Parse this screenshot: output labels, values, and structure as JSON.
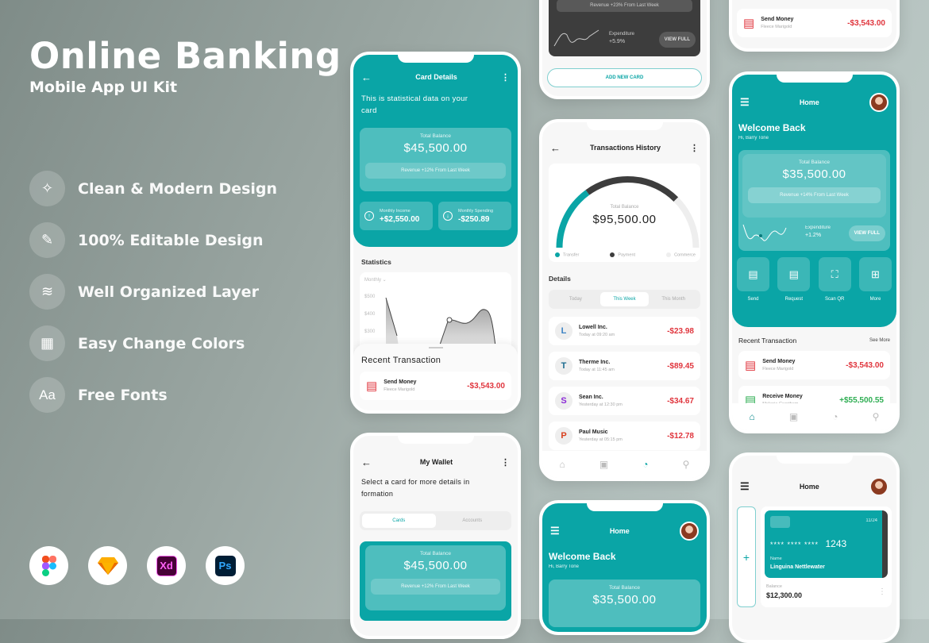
{
  "hero": {
    "title": "Online Banking",
    "subtitle": "Mobile App UI Kit"
  },
  "features": [
    {
      "icon": "magic-wand-icon",
      "glyph": "⁄",
      "label": "Clean & Modern Design"
    },
    {
      "icon": "pen-tool-icon",
      "glyph": "✎",
      "label": "100% Editable Design"
    },
    {
      "icon": "layers-icon",
      "glyph": "≋",
      "label": "Well Organized Layer"
    },
    {
      "icon": "color-swatch-icon",
      "glyph": "▦",
      "label": "Easy Change Colors"
    },
    {
      "icon": "font-icon",
      "glyph": "Aa",
      "label": "Free Fonts"
    }
  ],
  "tools": [
    {
      "name": "figma",
      "label": "F"
    },
    {
      "name": "sketch",
      "label": "◆"
    },
    {
      "name": "xd",
      "label": "Xd"
    },
    {
      "name": "photoshop",
      "label": "Ps"
    }
  ],
  "colors": {
    "accent": "#0aa5a6",
    "negative": "#e0363e",
    "positive": "#2fae53",
    "dark_card": "#3d3d3d"
  },
  "card_details": {
    "title": "Card Details",
    "intro": "This is statistical data on your card",
    "total_label": "Total Balance",
    "total_value": "$45,500.00",
    "revenue": "Revenue +12% From Last Week",
    "income_label": "Monthly Income",
    "income_value": "+$2,550.00",
    "spending_label": "Monthly Spending",
    "spending_value": "-$250.89",
    "stats_title": "Statistics",
    "period": "Monthly",
    "y_ticks": [
      "$500",
      "$400",
      "$300"
    ],
    "recent_title": "Recent Transaction",
    "tx": {
      "name": "Send Money",
      "sub": "Fleece Marigold",
      "amount": "-$3,543.00"
    }
  },
  "my_wallet": {
    "title": "My Wallet",
    "intro": "Select a card for more details in formation",
    "tabs": [
      "Cards",
      "Accounts"
    ],
    "total_label": "Total Balance",
    "total_value": "$45,500.00",
    "revenue": "Revenue +12% From Last Week"
  },
  "wallet_top": {
    "revenue": "Revenue +23% From Last Week",
    "exp_label": "Expenditure",
    "exp_value": "+5.9%",
    "view_full": "VIEW FULL",
    "add_card": "ADD NEW CARD"
  },
  "history": {
    "title": "Transactions History",
    "total_label": "Total Balance",
    "total_value": "$95,500.00",
    "gauge": {
      "transfer": 0.3,
      "payment": 0.45,
      "commerce": 0.25
    },
    "legend": [
      "Transfer",
      "Payment",
      "Commerce"
    ],
    "details_title": "Details",
    "tabs": [
      "Today",
      "This Week",
      "This Month"
    ],
    "rows": [
      {
        "logo": "L",
        "color": "#3b82c4",
        "name": "Lowell Inc.",
        "sub": "Today at 09:20 am",
        "amount": "-$23.98"
      },
      {
        "logo": "T",
        "color": "#1b6b8f",
        "name": "Therme Inc.",
        "sub": "Today at 11:45 am",
        "amount": "-$89.45"
      },
      {
        "logo": "S",
        "color": "#8b2ad6",
        "name": "Sean Inc.",
        "sub": "Yesterday at 12:30 pm",
        "amount": "-$34.67"
      },
      {
        "logo": "P",
        "color": "#d8401f",
        "name": "Paul Music",
        "sub": "Yesterday at 05:15 pm",
        "amount": "-$12.78"
      }
    ]
  },
  "home_bottom": {
    "title": "Home",
    "welcome": "Welcome Back",
    "greeting": "Hi, Barry Tone",
    "total_label": "Total Balance",
    "total_value": "$35,500.00"
  },
  "home_top_tx": {
    "name": "Send Money",
    "sub": "Fleece Marigold",
    "amount": "-$3,543.00"
  },
  "home": {
    "title": "Home",
    "welcome": "Welcome Back",
    "greeting": "Hi, Barry Tone",
    "total_label": "Total Balance",
    "total_value": "$35,500.00",
    "revenue": "Revenue +14% From Last Week",
    "exp_label": "Expenditure",
    "exp_value": "+1.2%",
    "view_full": "VIEW FULL",
    "actions": [
      "Send",
      "Request",
      "Scan QR",
      "More"
    ],
    "recent_title": "Recent Transaction",
    "see_more": "See More",
    "tx": [
      {
        "name": "Send Money",
        "sub": "Fleece Marigold",
        "amount": "-$3,543.00"
      },
      {
        "name": "Receive Money",
        "sub": "Melanie Grantham",
        "amount": "+$55,500.55"
      }
    ]
  },
  "cards_home": {
    "title": "Home",
    "expiry": "11/24",
    "masked": "****  ****  ****",
    "last4": "1243",
    "name_label": "Name",
    "name": "Linguina Nettlewater",
    "balance_label": "Balance",
    "balance": "$12,300.00"
  }
}
